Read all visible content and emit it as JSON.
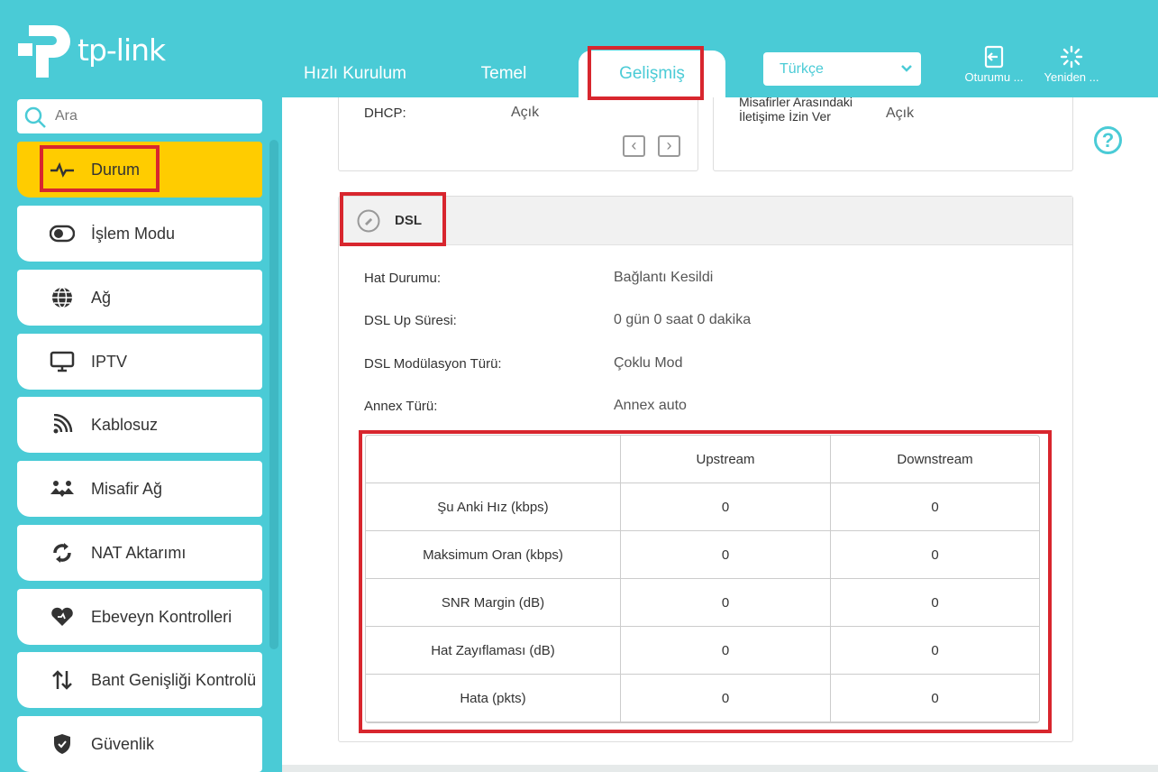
{
  "brand": {
    "name": "tp-link"
  },
  "nav": {
    "tabs": [
      {
        "label": "Hızlı Kurulum"
      },
      {
        "label": "Temel"
      },
      {
        "label": "Gelişmiş"
      }
    ],
    "language": "Türkçe",
    "logout_label": "Oturumu ...",
    "reboot_label": "Yeniden ..."
  },
  "search": {
    "placeholder": "Ara"
  },
  "sidebar": {
    "items": [
      {
        "label": "Durum",
        "icon": "activity-icon"
      },
      {
        "label": "İşlem Modu",
        "icon": "toggle-icon"
      },
      {
        "label": "Ağ",
        "icon": "globe-icon"
      },
      {
        "label": "IPTV",
        "icon": "monitor-icon"
      },
      {
        "label": "Kablosuz",
        "icon": "wifi-icon"
      },
      {
        "label": "Misafir Ağ",
        "icon": "guests-icon"
      },
      {
        "label": "NAT Aktarımı",
        "icon": "nat-icon"
      },
      {
        "label": "Ebeveyn Kontrolleri",
        "icon": "heart-icon"
      },
      {
        "label": "Bant Genişliği Kontrolü",
        "icon": "bandwidth-icon"
      },
      {
        "label": "Güvenlik",
        "icon": "shield-icon"
      }
    ]
  },
  "top_left_card": {
    "label": "DHCP:",
    "value": "Açık"
  },
  "top_right_card": {
    "label_line1": "Misafirler Arasındaki",
    "label_line2": "İletişime İzin Ver",
    "value": "Açık"
  },
  "dsl": {
    "title": "DSL",
    "rows": [
      {
        "label": "Hat Durumu:",
        "value": "Bağlantı Kesildi"
      },
      {
        "label": "DSL Up Süresi:",
        "value": "0 gün 0 saat 0 dakika"
      },
      {
        "label": "DSL Modülasyon Türü:",
        "value": "Çoklu Mod"
      },
      {
        "label": "Annex Türü:",
        "value": "Annex auto"
      }
    ],
    "table": {
      "headers": [
        "",
        "Upstream",
        "Downstream"
      ],
      "rows": [
        {
          "name": "Şu Anki Hız (kbps)",
          "up": "0",
          "down": "0"
        },
        {
          "name": "Maksimum Oran (kbps)",
          "up": "0",
          "down": "0"
        },
        {
          "name": "SNR Margin (dB)",
          "up": "0",
          "down": "0"
        },
        {
          "name": "Hat Zayıflaması (dB)",
          "up": "0",
          "down": "0"
        },
        {
          "name": "Hata (pkts)",
          "up": "0",
          "down": "0"
        }
      ]
    }
  },
  "colors": {
    "brand": "#4acbd6",
    "active_menu": "#ffcc00",
    "highlight": "#d8262e"
  }
}
